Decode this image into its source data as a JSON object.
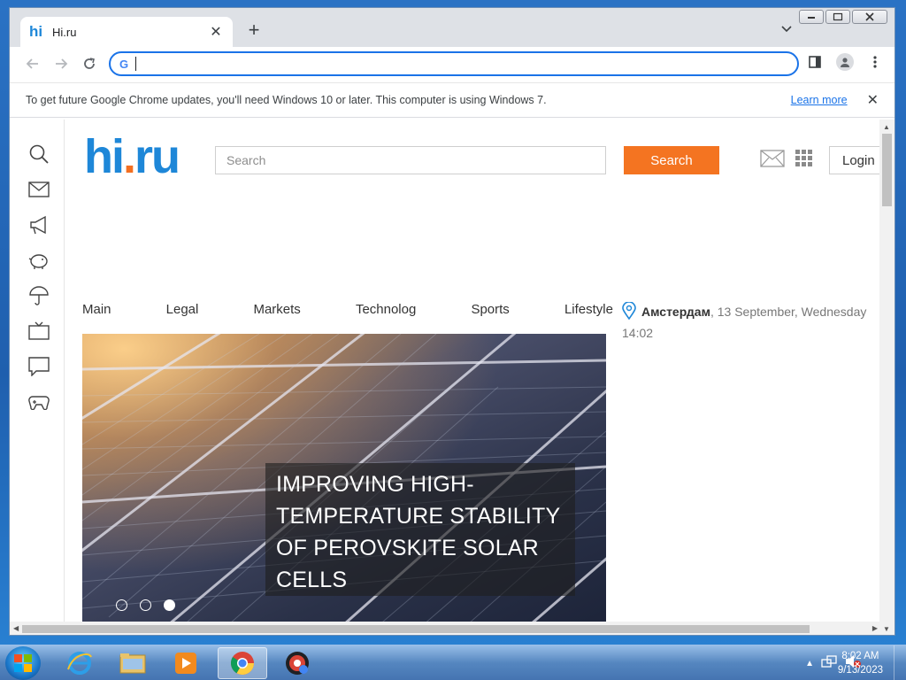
{
  "browser": {
    "tab_title": "Hi.ru",
    "tab_favicon_text": "hi",
    "omnibox_value": "",
    "omnibox_placeholder": "",
    "infobar": {
      "message": "To get future Google Chrome updates, you'll need Windows 10 or later. This computer is using Windows 7.",
      "link": "Learn more"
    }
  },
  "site": {
    "logo_main": "hi",
    "logo_dot": ".",
    "logo_tld": "ru",
    "search_placeholder": "Search",
    "search_button": "Search",
    "login_button": "Login",
    "nav": [
      "Main",
      "Legal",
      "Markets",
      "Technolog",
      "Sports",
      "Lifestyle"
    ],
    "location": {
      "city": "Амстердам",
      "date": ", 13 September, Wednesday",
      "time": "14:02"
    },
    "hero": {
      "caption": "IMPROVING HIGH-TEMPERATURE STABILITY OF PEROVSKITE SOLAR CELLS",
      "slides": 3,
      "active_slide": 3
    },
    "left_rail_icons": [
      "search-icon",
      "mail-icon",
      "megaphone-icon",
      "piggy-bank-icon",
      "umbrella-icon",
      "tv-icon",
      "chat-icon",
      "gamepad-icon"
    ]
  },
  "taskbar": {
    "apps": [
      "internet-explorer-icon",
      "file-explorer-icon",
      "media-player-icon",
      "chrome-icon",
      "chrome-update-icon"
    ],
    "clock_time": "8:02 AM",
    "clock_date": "9/13/2023"
  },
  "colors": {
    "brand_blue": "#1e87d8",
    "brand_orange": "#f47421",
    "chrome_focus": "#1a73e8"
  }
}
